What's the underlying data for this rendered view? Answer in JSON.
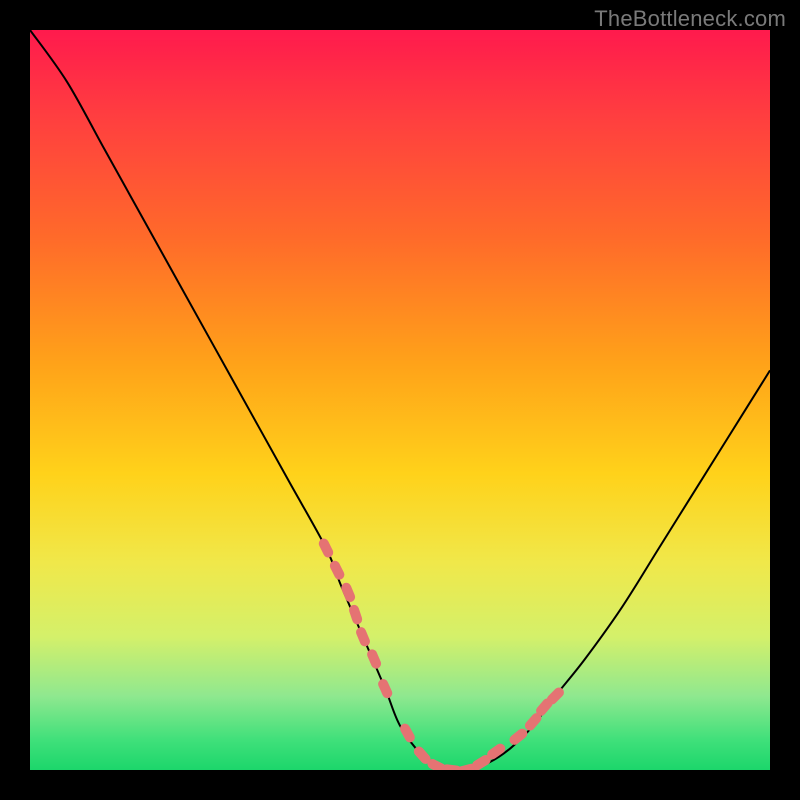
{
  "watermark": "TheBottleneck.com",
  "colors": {
    "background": "#000000",
    "curve": "#000000",
    "marker": "#e57373",
    "plot_gradient_top": "#ff1a4d",
    "plot_gradient_bottom": "#1cd66b"
  },
  "chart_data": {
    "type": "line",
    "title": "",
    "xlabel": "",
    "ylabel": "",
    "xlim": [
      0,
      100
    ],
    "ylim": [
      0,
      100
    ],
    "grid": false,
    "legend": false,
    "series": [
      {
        "name": "bottleneck-curve",
        "x": [
          0,
          5,
          10,
          15,
          20,
          25,
          30,
          35,
          40,
          42,
          45,
          48,
          50,
          53,
          56,
          59,
          62,
          65,
          68,
          71,
          75,
          80,
          85,
          90,
          95,
          100
        ],
        "y": [
          100,
          93,
          84,
          75,
          66,
          57,
          48,
          39,
          30,
          25,
          18,
          11,
          6,
          2,
          0,
          0,
          1,
          3,
          6,
          10,
          15,
          22,
          30,
          38,
          46,
          54
        ]
      }
    ],
    "markers": {
      "name": "highlight-points",
      "x": [
        40,
        41.5,
        43,
        44,
        45,
        46.5,
        48,
        51,
        53,
        55,
        57,
        59,
        61,
        63,
        66,
        68,
        69.5,
        71
      ],
      "y": [
        30,
        27,
        24,
        21,
        18,
        15,
        11,
        5,
        2,
        0.5,
        0,
        0,
        1,
        2.5,
        4.5,
        6.5,
        8.5,
        10
      ]
    }
  }
}
